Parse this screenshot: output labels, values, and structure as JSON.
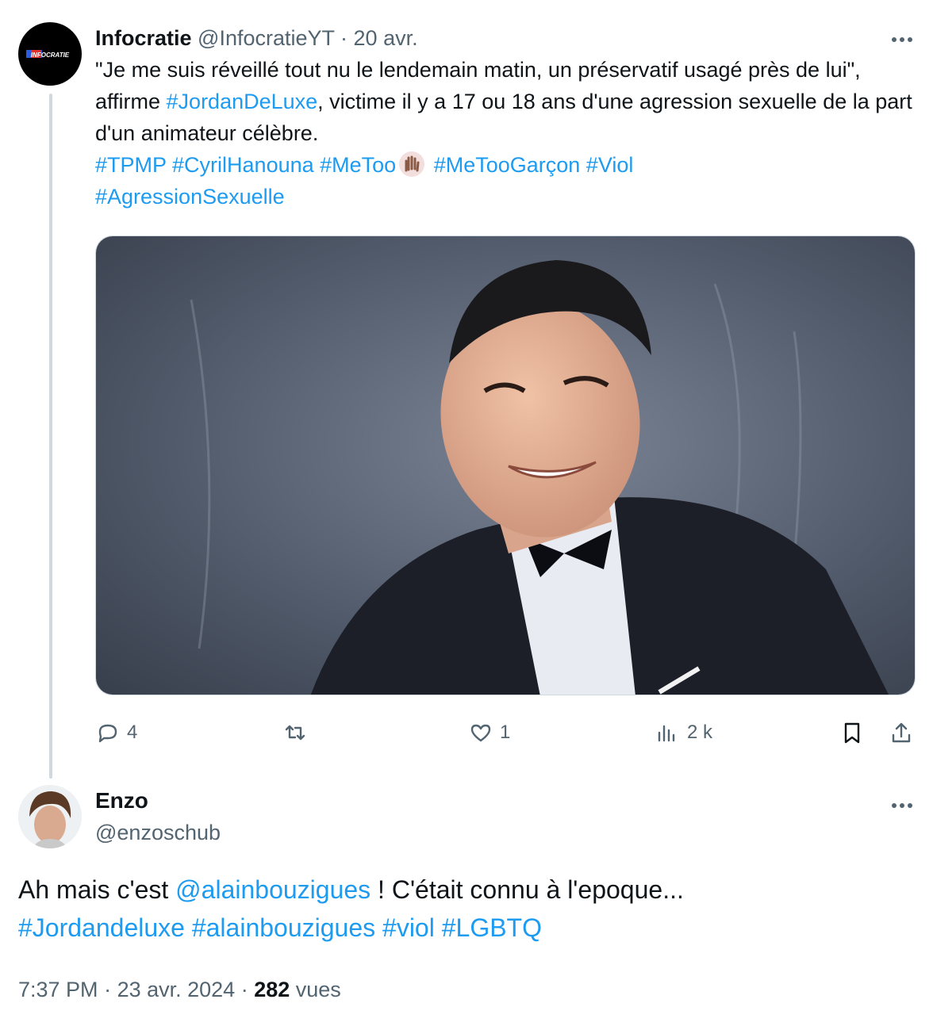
{
  "tweet1": {
    "display_name": "Infocratie",
    "handle": "@InfocratieYT",
    "separator": " · ",
    "date": "20 avr.",
    "avatar_text": "INFOCRATIE",
    "text_part1": "\"Je me suis réveillé tout nu le lendemain matin, un préservatif usagé près de lui\", affirme ",
    "hashtag_jordan": "#JordanDeLuxe",
    "text_part2": ", victime il y a 17 ou 18 ans d'une agression sexuelle de la part d'un animateur célèbre.",
    "tags_line1": "#TPMP #CyrilHanouna #MeToo",
    "tags_line1b": "#MeTooGarçon #Viol",
    "tags_line2": "#AgressionSexuelle",
    "emoji_icon": "raised-hand-icon",
    "image_icon": "portrait-photo",
    "actions": {
      "replies": "4",
      "retweets": "",
      "likes": "1",
      "views": "2 k"
    }
  },
  "tweet2": {
    "display_name": "Enzo",
    "handle": "@enzoschub",
    "text_before": "Ah mais c'est ",
    "mention": "@alainbouzigues",
    "text_after": " ! C'était connu à l'epoque...",
    "hashtags": "#Jordandeluxe #alainbouzigues #viol #LGBTQ",
    "time": "7:37 PM",
    "sep": " · ",
    "date": "23 avr. 2024",
    "sep2": " · ",
    "views_count": "282",
    "views_label": " vues"
  },
  "colors": {
    "link": "#1d9bf0",
    "muted": "#536471",
    "text": "#0f1419",
    "thread_line": "#cfd9de"
  }
}
